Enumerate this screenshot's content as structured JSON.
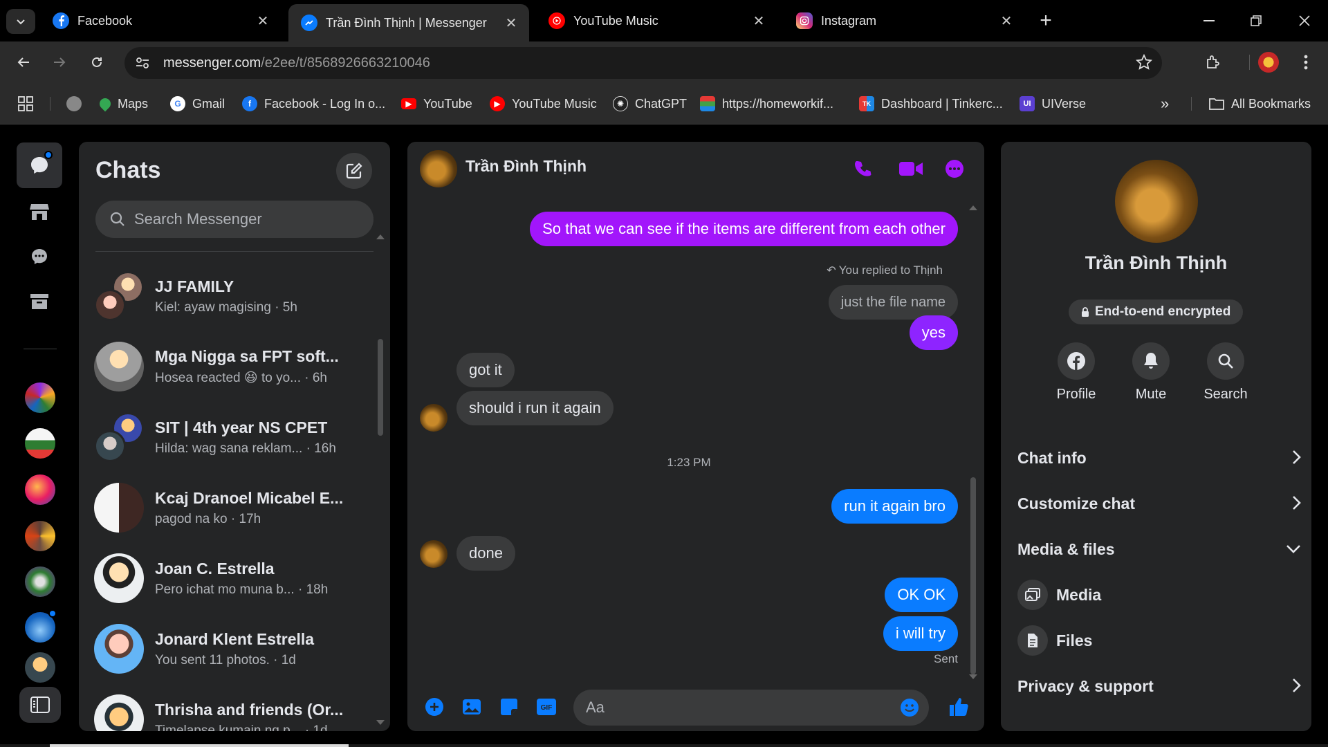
{
  "browser": {
    "tabs": [
      {
        "title": "Facebook",
        "icon": "facebook-icon",
        "color": "#1877f2"
      },
      {
        "title": "Trần Đình Thịnh | Messenger",
        "icon": "messenger-icon",
        "color": "#0a7cff",
        "active": true
      },
      {
        "title": "YouTube Music",
        "icon": "youtube-music-icon",
        "color": "#ff0000"
      },
      {
        "title": "Instagram",
        "icon": "instagram-icon",
        "color": "#e1306c"
      }
    ],
    "url_host": "messenger.com",
    "url_path": "/e2ee/t/8568926663210046",
    "bookmarks": [
      {
        "label": "Maps",
        "icon": "maps-icon"
      },
      {
        "label": "Gmail",
        "icon": "google-icon"
      },
      {
        "label": "Facebook - Log In o...",
        "icon": "facebook-icon"
      },
      {
        "label": "YouTube",
        "icon": "youtube-icon"
      },
      {
        "label": "YouTube Music",
        "icon": "youtube-music-icon"
      },
      {
        "label": "ChatGPT",
        "icon": "chatgpt-icon"
      },
      {
        "label": "https://homeworkif...",
        "icon": "books-icon"
      },
      {
        "label": "Dashboard | Tinkerc...",
        "icon": "tinkercad-icon"
      },
      {
        "label": "UIVerse",
        "icon": "uiverse-icon"
      }
    ],
    "all_bookmarks": "All Bookmarks"
  },
  "chats_panel": {
    "title": "Chats",
    "search_placeholder": "Search Messenger",
    "items": [
      {
        "name": "JJ FAMILY",
        "preview": "Kiel: ayaw magising · 5h"
      },
      {
        "name": "Mga Nigga sa FPT soft...",
        "preview": "Hosea reacted 😆 to yo... · 6h"
      },
      {
        "name": "SIT | 4th year NS CPET",
        "preview": "Hilda: wag sana reklam... · 16h"
      },
      {
        "name": "Kcaj Dranoel Micabel E...",
        "preview": "pagod na ko · 17h"
      },
      {
        "name": "Joan C. Estrella",
        "preview": "Pero ichat mo muna b... · 18h"
      },
      {
        "name": "Jonard Klent Estrella",
        "preview": "You sent 11 photos. · 1d"
      },
      {
        "name": "Thrisha and friends (Or...",
        "preview": "Timelapse kumain ng p... · 1d"
      }
    ]
  },
  "conversation": {
    "contact": "Trần Đình Thịnh",
    "messages": {
      "m1": "So that we can see if the items are different from each other",
      "reply_note": "You replied to Thịnh",
      "quoted": "just the file name",
      "m2": "yes",
      "m3": "got it",
      "m4": "should i run it again",
      "time": "1:23 PM",
      "m5": "run it again bro",
      "m6": "done",
      "m7": "OK OK",
      "m8": "i will try",
      "status": "Sent"
    },
    "composer_placeholder": "Aa"
  },
  "info_panel": {
    "name": "Trần Đình Thịnh",
    "encrypted": "End-to-end encrypted",
    "actions": [
      "Profile",
      "Mute",
      "Search"
    ],
    "rows": {
      "chat_info": "Chat info",
      "customize": "Customize chat",
      "media_files": "Media & files",
      "media": "Media",
      "files": "Files",
      "privacy": "Privacy & support"
    }
  },
  "colors": {
    "accent": "#0a7cff",
    "purple": "#a216fb",
    "panel": "#242526"
  }
}
